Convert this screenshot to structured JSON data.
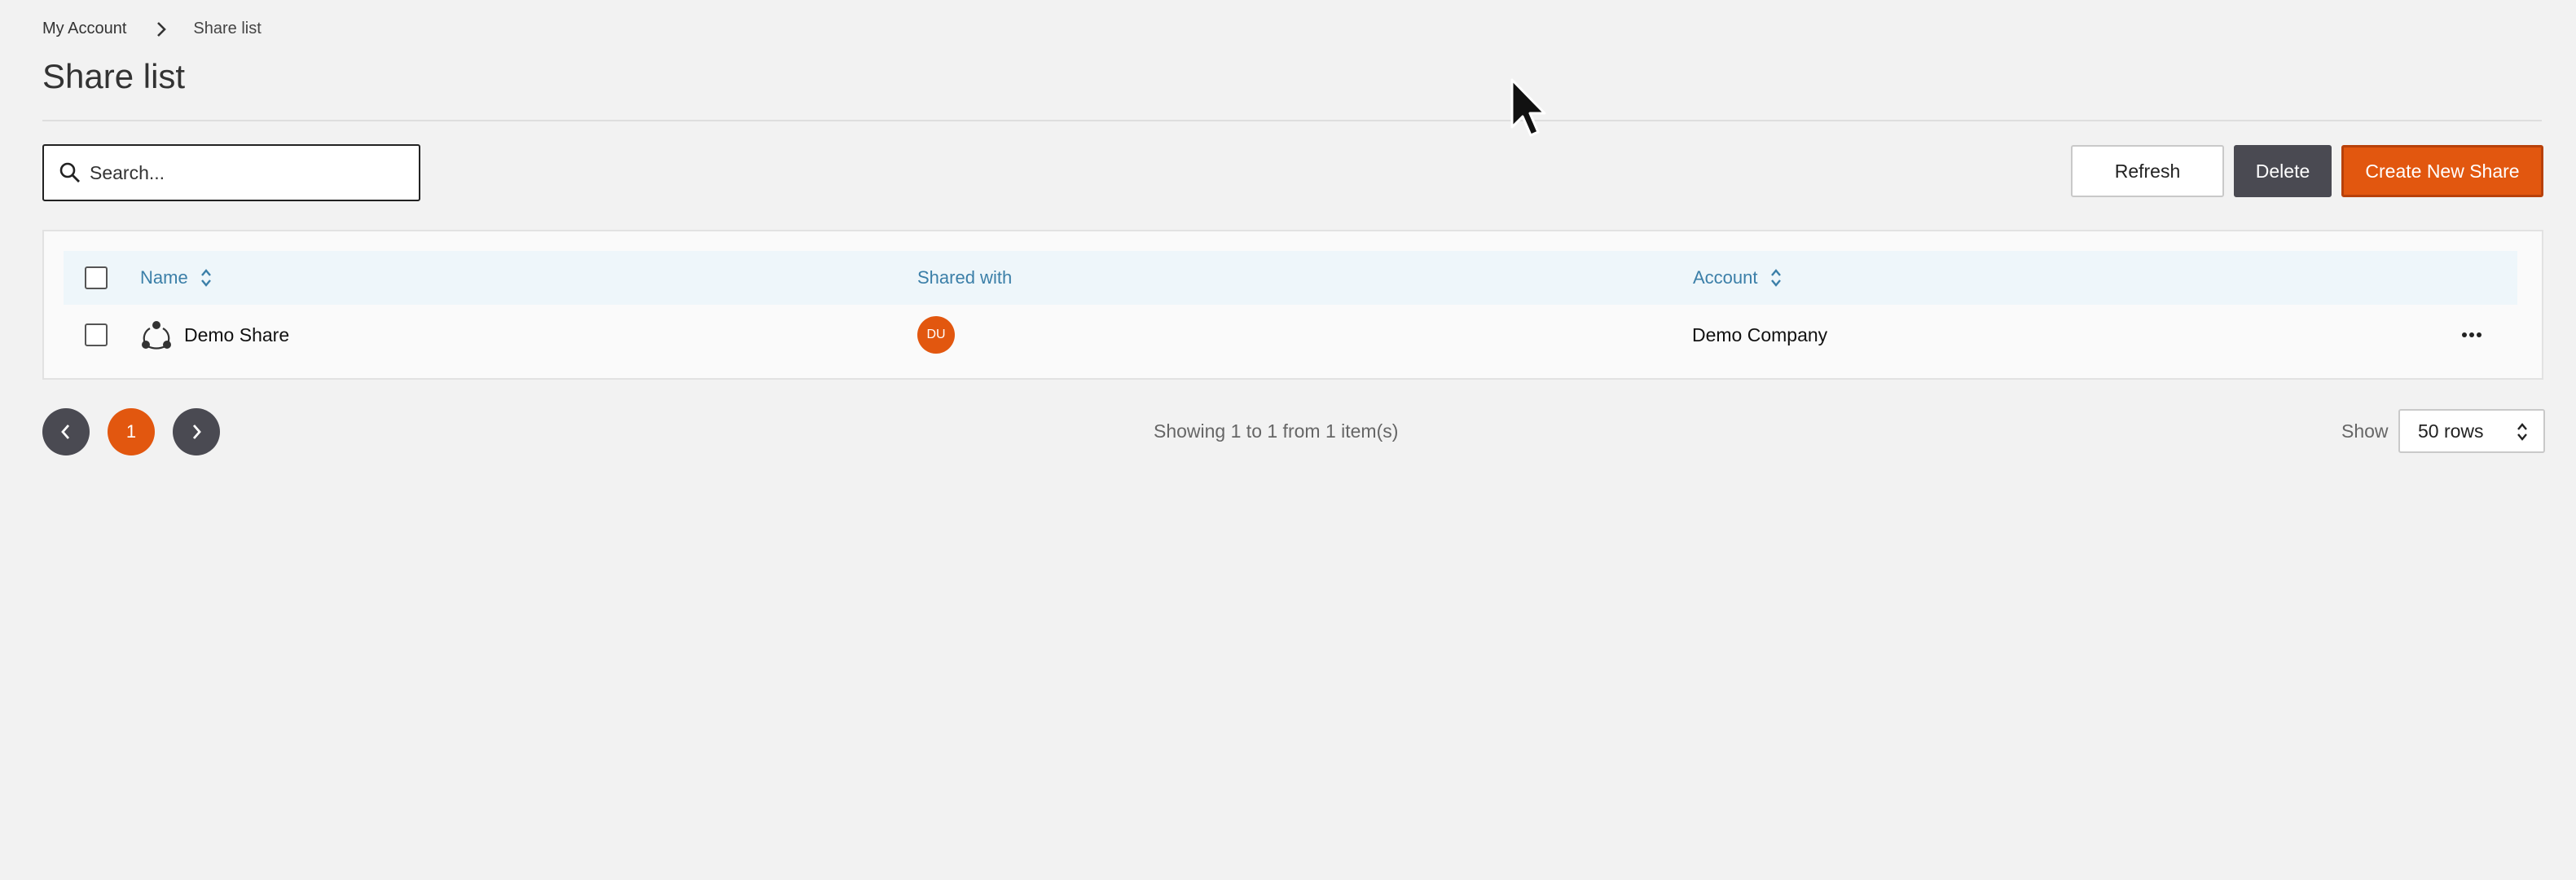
{
  "breadcrumb": {
    "items": [
      "My Account",
      "Share list"
    ]
  },
  "page": {
    "title": "Share list"
  },
  "search": {
    "placeholder": "Search..."
  },
  "toolbar": {
    "refresh_label": "Refresh",
    "delete_label": "Delete",
    "create_label": "Create New Share"
  },
  "table": {
    "columns": [
      "Name",
      "Shared with",
      "Account"
    ],
    "rows": [
      {
        "name": "Demo Share",
        "shared_with_initials": "DU",
        "account": "Demo Company"
      }
    ]
  },
  "pagination": {
    "current_page": "1",
    "summary": "Showing 1 to 1 from 1 item(s)",
    "show_label": "Show",
    "rows_value": "50 rows"
  },
  "colors": {
    "accent": "#e2570f",
    "dark_button": "#4a4a52",
    "link_blue": "#3b7fa8",
    "header_bg": "#eef6fa"
  },
  "icons": [
    "chevron-right-icon",
    "search-icon",
    "sort-icon",
    "share-network-icon",
    "more-horizontal-icon",
    "chevron-left-icon",
    "select-caret-icon",
    "mouse-cursor-icon"
  ]
}
